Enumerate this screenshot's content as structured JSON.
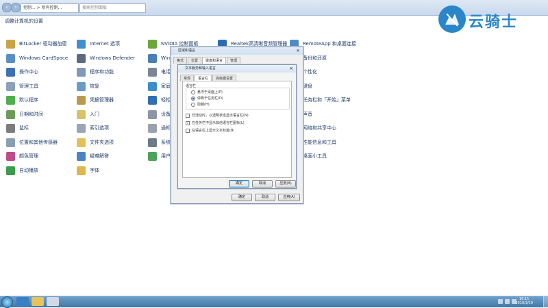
{
  "address_bar": {
    "breadcrumb": "控制... > 所有控制...",
    "search_placeholder": "搜索控制面板"
  },
  "heading": "调整计算机的设置",
  "logo": {
    "text": "云骑士"
  },
  "columns": [
    [
      "BitLocker 驱动器加密",
      "Windows CardSpace",
      "操作中心",
      "管理工具",
      "默认程序",
      "日期和时间",
      "鼠标",
      "位置和其他传感器",
      "颜色管理",
      "自动播放"
    ],
    [
      "Internet 选项",
      "Windows Defender",
      "程序和功能",
      "恢复",
      "凭据管理器",
      "入门",
      "索引选项",
      "文件夹选项",
      "疑难解答",
      "字体"
    ],
    [
      "NVIDIA 控制面板",
      "Windows",
      "电话和",
      "家庭组",
      "轻松访",
      "设备管",
      "通知区",
      "系统",
      "用户帐"
    ],
    [
      "Realtek高清晰音频管理器"
    ],
    [
      "RemoteApp 和桌面连接",
      "备份和还原",
      "个性化",
      "键盘",
      "任务栏和「开始」菜单",
      "声音",
      "网络和共享中心",
      "性能信息和工具",
      "桌面小工具"
    ]
  ],
  "region_dialog": {
    "title": "区域和语言",
    "tabs": [
      "格式",
      "位置",
      "键盘和语言",
      "管理"
    ],
    "buttons": [
      "确定",
      "取消",
      "应用(A)"
    ]
  },
  "text_services_dialog": {
    "title": "文本服务和输入语言",
    "tabs": [
      "常规",
      "语言栏",
      "高级键设置"
    ],
    "group_label": "语言栏",
    "radios": [
      "悬浮于桌面上(F)",
      "停靠于任务栏(D)",
      "隐藏(H)"
    ],
    "selected_radio": 1,
    "checkboxes": [
      "非活动时，以透明状态显示语言栏(N)",
      "在任务栏中显示其他语言栏图标(L)",
      "在语言栏上显示文本标签(B)"
    ],
    "checked": [
      false,
      true,
      false
    ],
    "buttons": [
      "确定",
      "取消",
      "应用(A)"
    ]
  },
  "taskbar": {
    "time": "16:11",
    "date": "2019/3/19"
  },
  "colors": {
    "link": "#1e3a68",
    "logo": "#2a86c9",
    "taskbar": "#3f78a8"
  }
}
